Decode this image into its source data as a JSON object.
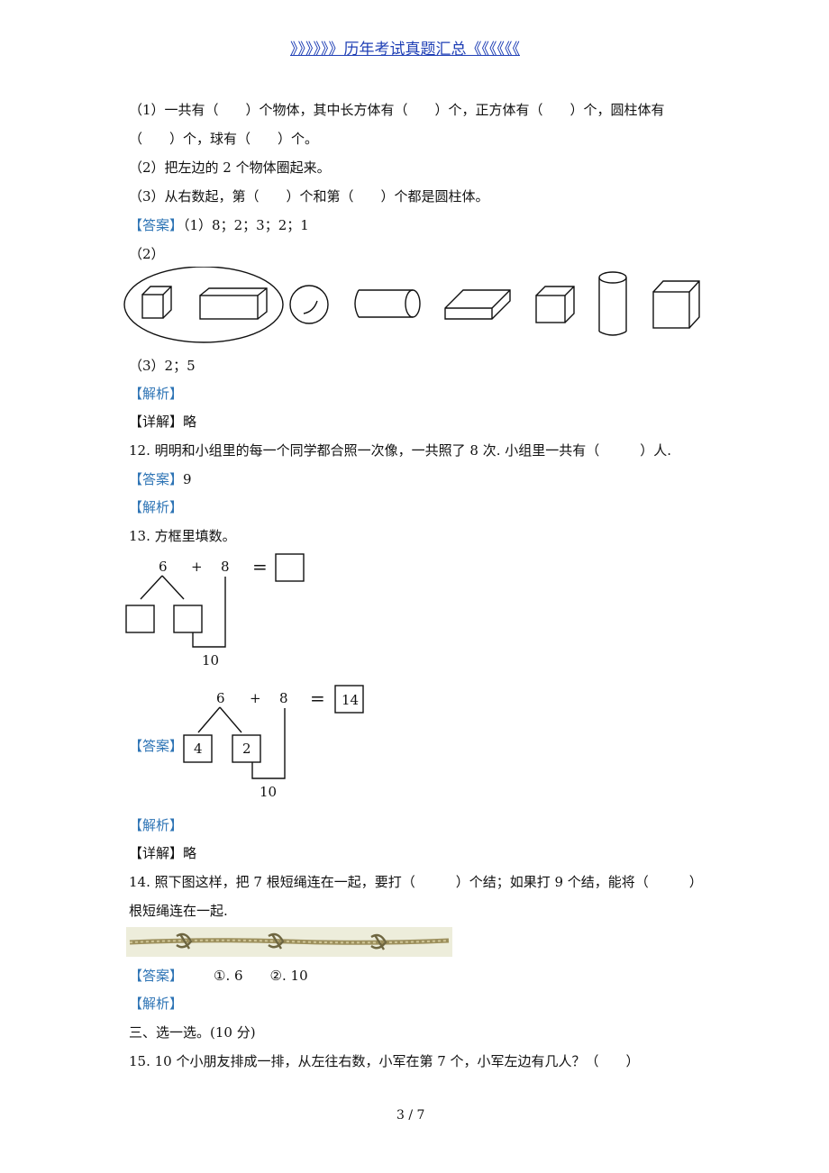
{
  "header": {
    "banner": "》》》》》》历年考试真题汇总《《《《《《"
  },
  "q11": {
    "part1_line1": "（1）一共有（　　）个物体，其中长方体有（　　）个，正方体有（　　）个，圆柱体有",
    "part1_line2": "（　　）个，球有（　　）个。",
    "part2": "（2）把左边的 2 个物体圈起来。",
    "part3": "（3）从右数起，第（　　）个和第（　　）个都是圆柱体。",
    "answer_tag": "【答案】",
    "answer1": "（1）8；2；3；2；1",
    "answer2_label": "（2）",
    "answer3": "（3）2；5",
    "analysis_tag": "【解析】",
    "detail_tag": "【详解】",
    "detail_text": "略"
  },
  "q12": {
    "question": "12.  明明和小组里的每一个同学都合照一次像，一共照了 8 次. 小组里一共有（　　　）人.",
    "answer_tag": "【答案】",
    "answer": "9",
    "analysis_tag": "【解析】"
  },
  "q13": {
    "question": "13.  方框里填数。",
    "diagram": {
      "a": "6",
      "op": "+",
      "b": "8",
      "eq": "=",
      "ten": "10"
    },
    "answer_tag": "【答案】",
    "answer_diagram": {
      "a": "6",
      "op": "+",
      "b": "8",
      "eq": "=",
      "result": "14",
      "split1": "4",
      "split2": "2",
      "ten": "10"
    },
    "analysis_tag": "【解析】",
    "detail_tag": "【详解】",
    "detail_text": "略"
  },
  "q14": {
    "question_line1": "14.  照下图这样，把 7 根短绳连在一起，要打（　　　）个结；如果打 9 个结，能将（　　　）",
    "question_line2": "根短绳连在一起.",
    "answer_tag": "【答案】",
    "answer_text": "①. 6　　②. 10",
    "analysis_tag": "【解析】"
  },
  "section3": {
    "title": "三、选一选。(10 分)"
  },
  "q15": {
    "question": "15.  10 个小朋友排成一排，从左往右数，小军在第 7 个，小军左边有几人？（　　）"
  },
  "footer": {
    "page": "3 / 7"
  },
  "colors": {
    "tag": "#2e74b5",
    "banner": "#1f3fb5",
    "rope": "#a89c6a"
  }
}
